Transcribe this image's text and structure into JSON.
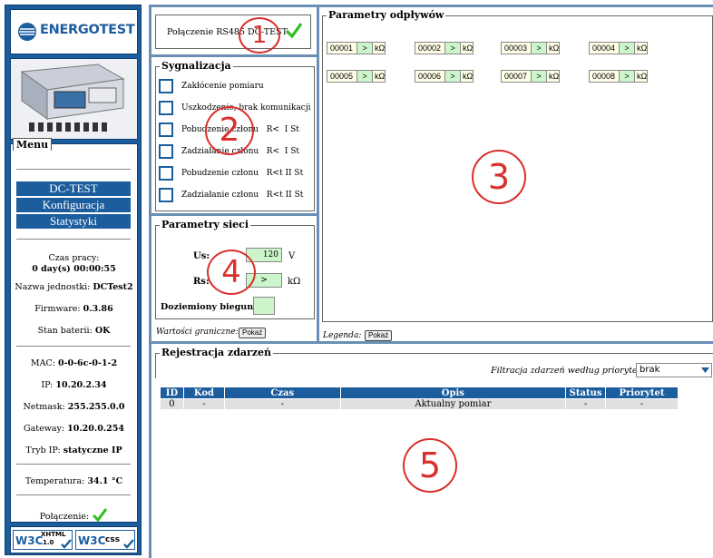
{
  "brand": {
    "name": "ENERGOTEST"
  },
  "menu": {
    "legend": "Menu",
    "items": [
      "DC-TEST",
      "Konfiguracja",
      "Statystyki"
    ]
  },
  "status": {
    "uptime_label": "Czas pracy:",
    "uptime_value": "0 day(s) 00:00:55",
    "unit_name_label": "Nazwa jednostki:",
    "unit_name_value": "DCTest2",
    "firmware_label": "Firmware:",
    "firmware_value": "0.3.86",
    "battery_label": "Stan baterii:",
    "battery_value": "OK",
    "mac_label": "MAC:",
    "mac_value": "0-0-6c-0-1-2",
    "ip_label": "IP:",
    "ip_value": "10.20.2.34",
    "netmask_label": "Netmask:",
    "netmask_value": "255.255.0.0",
    "gateway_label": "Gateway:",
    "gateway_value": "10.20.0.254",
    "ipmode_label": "Tryb IP:",
    "ipmode_value": "statyczne IP",
    "temp_label": "Temperatura:",
    "temp_value": "34.1 °C",
    "conn_label": "Połączenie:"
  },
  "badges": {
    "w3c1": "W3C",
    "xhtml": "XHTML",
    "xhtml_ver": "1.0",
    "w3c2": "W3C",
    "css": "css"
  },
  "connection": {
    "label": "Połączenie RS485 DC-TEST"
  },
  "signaling": {
    "legend": "Sygnalizacja",
    "items": [
      "Zakłócenie pomiaru",
      "Uszkodzenie, brak komunikacji",
      "Pobudzenie członu   R<  I St",
      "Zadziałanie członu   R<  I St",
      "Pobudzenie członu   R<t II St",
      "Zadziałanie członu   R<t II St"
    ]
  },
  "network": {
    "legend": "Parametry sieci",
    "us_label": "Us:",
    "us_value": "120",
    "us_unit": "V",
    "rs_label": "Rs:",
    "rs_value": ">",
    "rs_unit": "kΩ",
    "ground_label": "Doziemiony biegun:",
    "limits_label": "Wartości graniczne:",
    "show_btn": "Pokaż"
  },
  "outputs": {
    "legend": "Parametry odpływów",
    "items": [
      {
        "id": "00001",
        "val": ">",
        "unit": "kΩ"
      },
      {
        "id": "00002",
        "val": ">",
        "unit": "kΩ"
      },
      {
        "id": "00003",
        "val": ">",
        "unit": "kΩ"
      },
      {
        "id": "00004",
        "val": ">",
        "unit": "kΩ"
      },
      {
        "id": "00005",
        "val": ">",
        "unit": "kΩ"
      },
      {
        "id": "00006",
        "val": ">",
        "unit": "kΩ"
      },
      {
        "id": "00007",
        "val": ">",
        "unit": "kΩ"
      },
      {
        "id": "00008",
        "val": ">",
        "unit": "kΩ"
      }
    ],
    "legend_label": "Legenda:",
    "show_btn": "Pokaż"
  },
  "events": {
    "legend": "Rejestracja zdarzeń",
    "filter_label": "Filtracja zdarzeń według priorytetu:",
    "filter_value": "brak",
    "columns": [
      "ID",
      "Kod",
      "Czas",
      "Opis",
      "Status",
      "Priorytet"
    ],
    "rows": [
      [
        "0",
        "-",
        "-",
        "Aktualny pomiar",
        "-",
        "-"
      ]
    ]
  },
  "annotations": [
    "1",
    "2",
    "3",
    "4",
    "5"
  ],
  "colors": {
    "accent": "#1c5d9e",
    "annotation": "#d8302c",
    "ok": "#2fbf1f"
  }
}
